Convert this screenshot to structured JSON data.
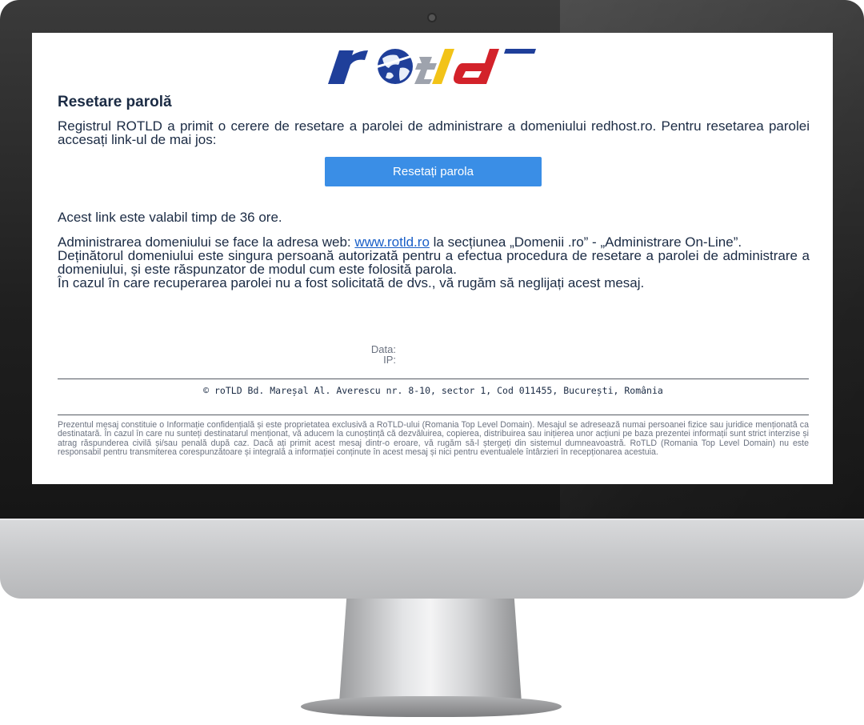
{
  "email": {
    "logo_text": "rotld",
    "heading": "Resetare parolă",
    "intro": "Registrul ROTLD a primit o cerere de resetare a parolei de administrare a domeniului redhost.ro. Pentru resetarea parolei accesați link-ul de mai jos:",
    "reset_button_label": "Resetați parola",
    "validity_text": "Acest link este valabil timp de 36 ore.",
    "admin_text_before": "Administrarea domeniului se face la adresa web:",
    "admin_link": "www.rotld.ro",
    "admin_text_after": "la secțiunea „Domenii .ro” - „Administrare On-Line”.",
    "owner_text": "Deținătorul domeniului este singura persoană autorizată pentru a efectua procedura de resetare a parolei de administrare a domeniului, și este răspunzator de modul cum este folosită parola.",
    "ignore_text": "În cazul în care recuperarea parolei nu a fost solicitată de dvs., vă rugăm să neglijați acest mesaj.",
    "meta": {
      "date_label": "Data:",
      "ip_label": "IP:"
    },
    "footer_address": "© roTLD Bd. Mareșal Al. Averescu nr. 8-10, sector 1, Cod 011455, București, România",
    "disclaimer": "Prezentul mesaj constituie o Informație confidențială și este proprietatea exclusivă a RoTLD-ului (Romania Top Level Domain). Mesajul se adresează numai persoanei fizice sau juridice menționată ca destinatară. În cazul în care nu sunteți destinatarul menționat, vă aducem la cunoștință că dezvăluirea, copierea, distribuirea sau inițierea unor acțiuni pe baza prezentei informații sunt strict interzise și atrag răspunderea civilă și/sau penală după caz. Dacă ați primit acest mesaj dintr-o eroare, vă rugăm să-l ștergeți din sistemul dumneavoastră. RoTLD (Romania Top Level Domain) nu este responsabil pentru transmiterea corespunzătoare și integrală a informației conținute în acest mesaj și nici pentru eventualele întârzieri în recepționarea acestuia."
  },
  "colors": {
    "text": "#1b2b44",
    "button": "#3a8ee6",
    "link": "#1a5fc7",
    "logo_blue": "#1f3f9a",
    "logo_gray": "#9ea3ad",
    "logo_yellow": "#f2c318",
    "logo_red": "#d3222a"
  },
  "icons": [
    "globe-icon"
  ]
}
